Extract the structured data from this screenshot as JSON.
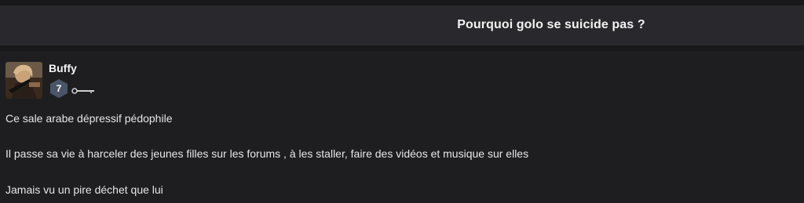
{
  "thread": {
    "title": "Pourquoi golo se suicide pas ?"
  },
  "post": {
    "author": "Buffy",
    "level": "7",
    "lines": [
      "Ce sale arabe dépressif pédophile",
      "Il passe sa vie à harceler des jeunes filles sur les forums , à les staller, faire des vidéos et musique sur elles",
      "Jamais vu un pire déchet que lui"
    ]
  },
  "icons": {
    "level_badge": "hexagon-level-icon",
    "rank_badge": "key-badge-icon"
  },
  "colors": {
    "background": "#1e1e21",
    "header": "#29292d",
    "badge": "#4a5568"
  }
}
